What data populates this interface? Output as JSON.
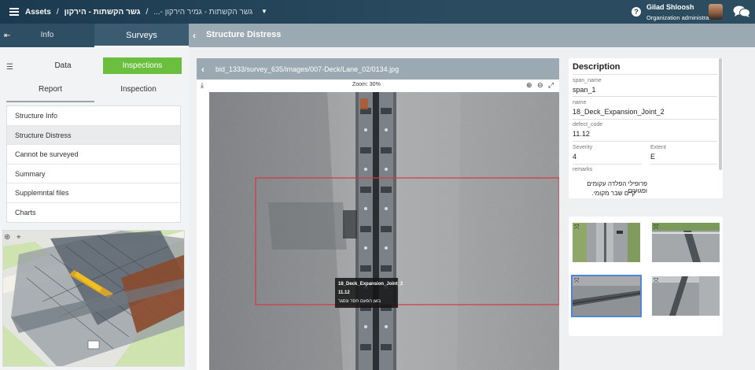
{
  "topbar": {
    "assets": "Assets",
    "sep": "/",
    "crumb_bridge": "גשר הקשתות - הירקון",
    "crumb_dim": "גשר הקשתות - גמיר הירקון -...",
    "user_name": "Gilad Shloosh",
    "user_role": "Organization administrator"
  },
  "leftnav": {
    "info": "Info",
    "surveys": "Surveys"
  },
  "leftpanel": {
    "data": "Data",
    "inspections": "Inspections",
    "report": "Report",
    "inspection": "Inspection",
    "menu": [
      "Structure Info",
      "Structure Distress",
      "Cannot be surveyed",
      "Summary",
      "Supplemntal files",
      "Charts"
    ]
  },
  "main": {
    "title": "Structure Distress"
  },
  "viewer": {
    "path": "bid_1333/survey_635/images/007-Deck/Lane_02/0134.jpg",
    "zoom": "Zoom: 30%",
    "tooltip": {
      "name": "18_Deck_Expansion_Joint_2",
      "code": "11.12",
      "note": "בשן הפעם חסר ונסגר"
    }
  },
  "description": {
    "heading": "Description",
    "span_name_label": "span_name",
    "span_name": "span_1",
    "name_label": "name",
    "name": "18_Deck_Expansion_Joint_2",
    "defect_code_label": "defect_code",
    "defect_code": "11.12",
    "severity_label": "Severity",
    "severity": "4",
    "extent_label": "Extent",
    "extent": "E",
    "remarks_label": "remarks",
    "remarks_line1": "פרופילי הפלדה עקומים ופגועים",
    "remarks_line2": "קיים שבר מקומי."
  },
  "colors": {
    "accent_green": "#6bbf3f",
    "topbar": "#1b3a4f",
    "header_gray": "#9aa9b2",
    "selected_thumb": "#4f86d8",
    "defect_box": "#d9363e"
  }
}
